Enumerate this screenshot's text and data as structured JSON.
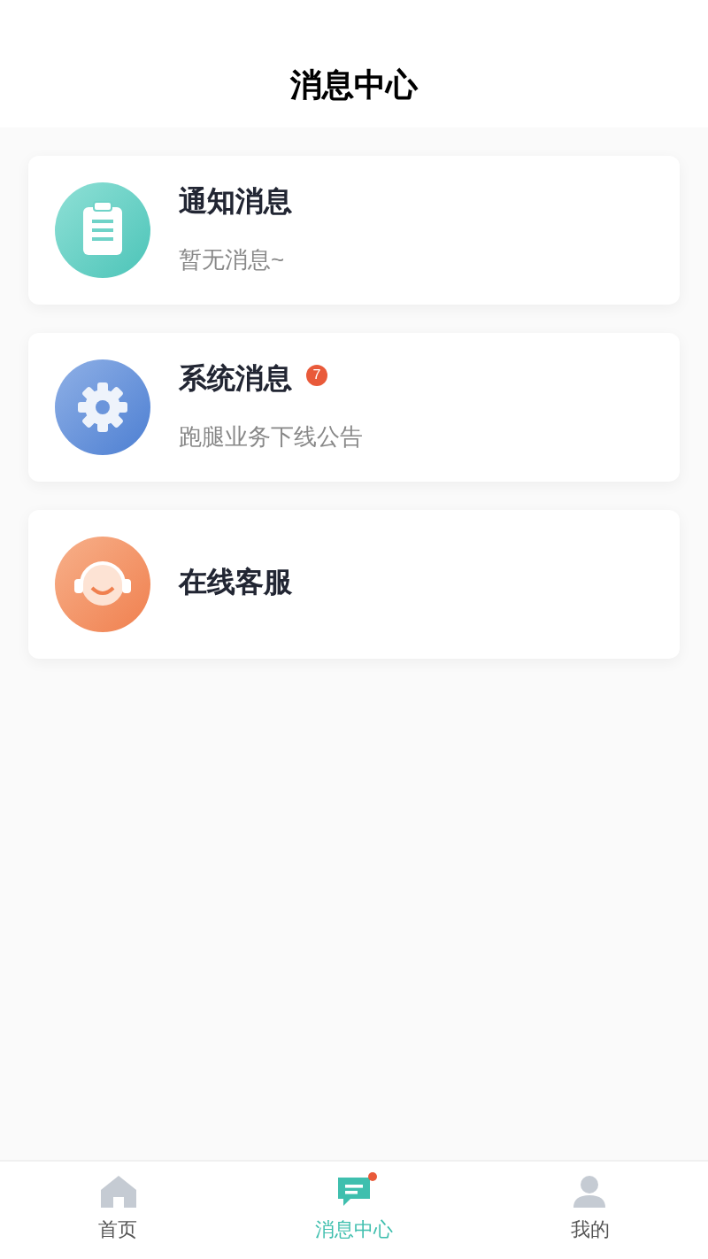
{
  "header": {
    "title": "消息中心"
  },
  "items": [
    {
      "kind": "notice",
      "title": "通知消息",
      "subtitle": "暂无消息~"
    },
    {
      "kind": "system",
      "title": "系统消息",
      "badge": "7",
      "subtitle": "跑腿业务下线公告"
    },
    {
      "kind": "service",
      "title": "在线客服"
    }
  ],
  "tabs": [
    {
      "kind": "home",
      "label": "首页",
      "selected": false,
      "dot": false
    },
    {
      "kind": "messages",
      "label": "消息中心",
      "selected": true,
      "dot": true
    },
    {
      "kind": "profile",
      "label": "我的",
      "selected": false,
      "dot": false
    }
  ]
}
